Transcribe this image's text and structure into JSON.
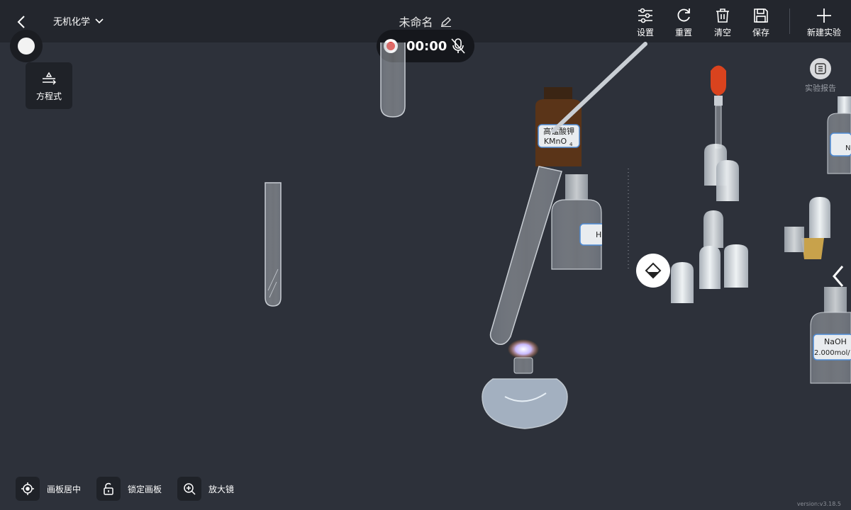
{
  "header": {
    "subject": "无机化学",
    "title": "未命名",
    "tools": {
      "settings": "设置",
      "reset": "重置",
      "clear": "清空",
      "save": "保存",
      "new_experiment": "新建实验"
    }
  },
  "recording": {
    "time": "00:00"
  },
  "equation_button": "方程式",
  "report_button": "实验报告",
  "reagents": {
    "kmno4": {
      "name": "高锰酸钾",
      "formula": "KMnO",
      "subscript": "4"
    },
    "h_bottle": {
      "name": "H"
    },
    "naoh": {
      "name": "NaOH",
      "conc": "2.000mol/"
    },
    "top_right": {
      "name": "N"
    }
  },
  "bottom": {
    "center_board": "画板居中",
    "lock_board": "锁定画板",
    "magnifier": "放大镜"
  },
  "version": "version:v3.18.5",
  "icons": [
    "back-icon",
    "chevron-down-icon",
    "edit-icon",
    "record-icon",
    "mic-off-icon",
    "equation-icon",
    "settings-icon",
    "reset-icon",
    "trash-icon",
    "save-icon",
    "plus-icon",
    "report-icon",
    "target-icon",
    "lock-icon",
    "zoom-in-icon",
    "chevron-left-icon"
  ]
}
